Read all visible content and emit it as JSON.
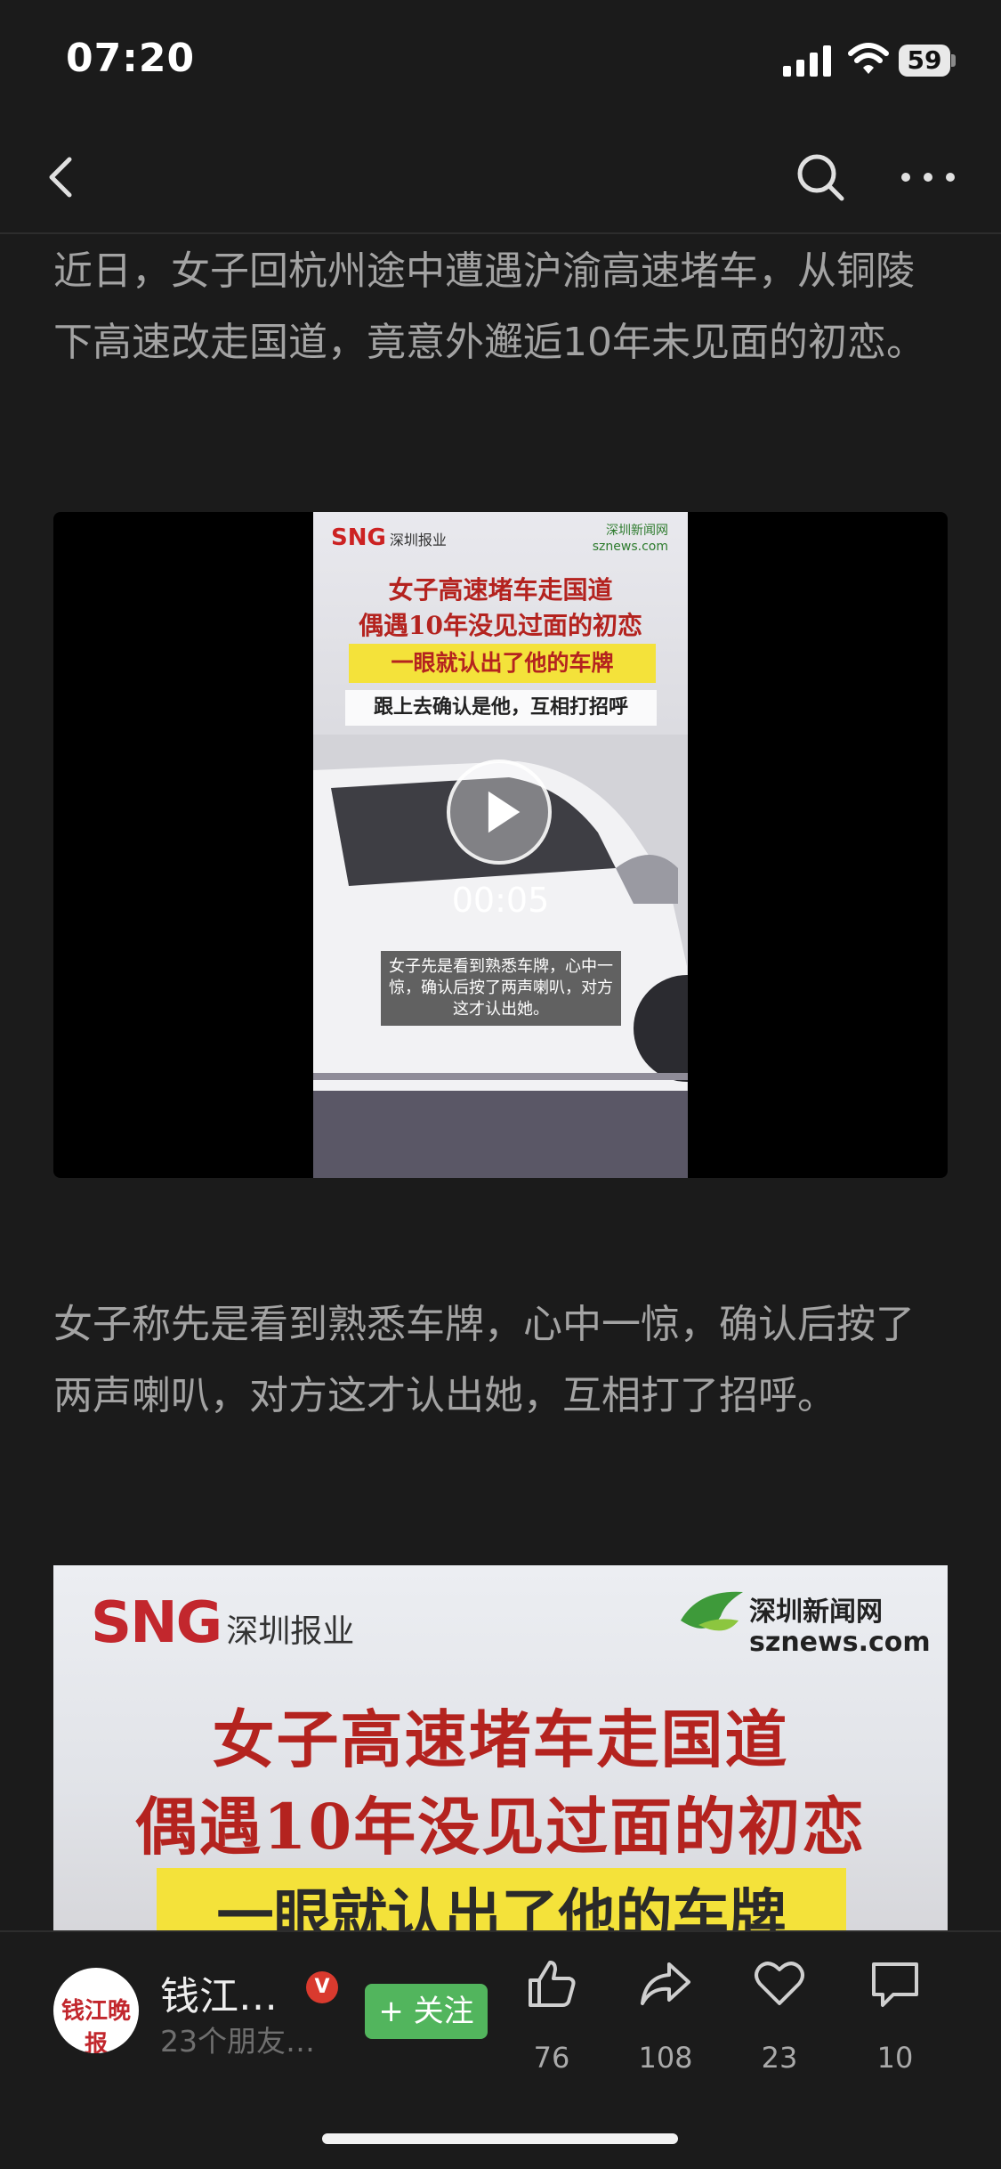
{
  "status_bar": {
    "time": "07:20",
    "battery": "59"
  },
  "nav": {
    "back_icon": "chevron-left-icon",
    "search_icon": "search-icon",
    "more_icon": "more-dots-icon"
  },
  "article": {
    "paragraph_1": "近日，女子回杭州途中遭遇沪渝高速堵车，从铜陵下高速改走国道，竟意外邂逅10年未见面的初恋。",
    "video": {
      "brand": "SNG",
      "brand_sub": "深圳报业",
      "site_logo": "深圳新闻网",
      "site_url": "sznews.com",
      "headline_1": "女子高速堵车走国道",
      "headline_2": "偶遇10年没见过面的初恋",
      "yellow_line": "一眼就认出了他的车牌",
      "white_line": "跟上去确认是他，互相打招呼",
      "subtitle": "女子先是看到熟悉车牌，心中一惊，确认后按了两声喇叭，对方这才认出她。",
      "duration": "00:05"
    },
    "paragraph_2": "女子称先是看到熟悉车牌，心中一惊，确认后按了两声喇叭，对方这才认出她，互相打了招呼。",
    "image": {
      "brand": "SNG",
      "brand_sub": "深圳报业",
      "site_logo": "深圳新闻网",
      "site_url": "sznews.com",
      "headline_1": "女子高速堵车走国道",
      "headline_2": "偶遇10年没见过面的初恋",
      "yellow_line": "一眼就认出了他的车牌"
    }
  },
  "bottom_bar": {
    "account_name": "钱江…",
    "avatar_text": "钱江晚报",
    "verified_badge": "V",
    "friends_text": "23个朋友…",
    "follow_label": "+ 关注",
    "like_count": "76",
    "share_count": "108",
    "favorite_count": "23",
    "comment_count": "10"
  },
  "colors": {
    "background": "#1b1b1b",
    "follow_green": "#52b55d",
    "verified_red": "#d93a2e",
    "headline_red": "#b4231f",
    "banner_yellow": "#f4e23a"
  }
}
